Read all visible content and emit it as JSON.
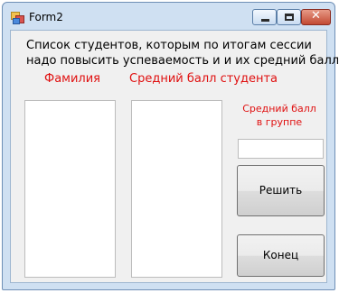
{
  "window": {
    "title": "Form2",
    "controls": {
      "minimize": "minimize",
      "maximize": "maximize",
      "close": "✕"
    }
  },
  "form": {
    "description_line1": "Список студентов, которым по итогам сессии",
    "description_line2": "надо повысить успеваемость и и их средний балл",
    "surname_label": "Фамилия",
    "avg_label": "Средний балл студента",
    "group_label_line1": "Средний балл",
    "group_label_line2": "в группе",
    "group_avg_value": "",
    "solve_button": "Решить",
    "end_button": "Конец"
  },
  "colors": {
    "label_red": "#e01010",
    "close_button": "#c24a33",
    "window_frame": "#cfe0f2",
    "client_bg": "#f0f0f0"
  },
  "lists": {
    "surnames": [],
    "averages": []
  }
}
